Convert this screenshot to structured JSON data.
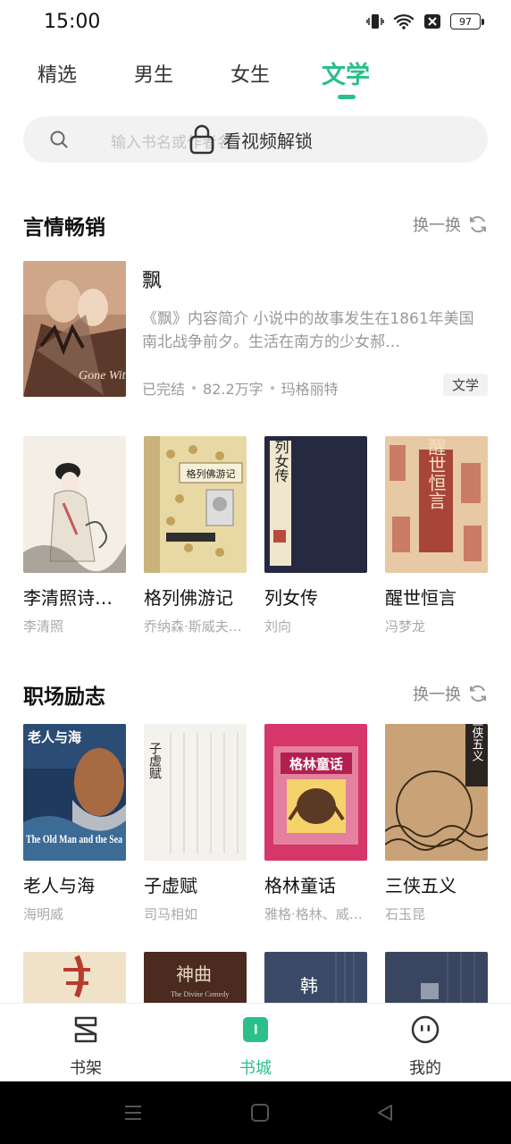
{
  "status": {
    "time": "15:00",
    "battery": "97"
  },
  "tabs": [
    {
      "label": "精选"
    },
    {
      "label": "男生"
    },
    {
      "label": "女生"
    },
    {
      "label": "文学",
      "active": true
    }
  ],
  "search": {
    "placeholder": "输入书名或作者名",
    "unlock_text": "看视频解锁"
  },
  "section1": {
    "title": "言情畅销",
    "refresh": "换一换"
  },
  "featured": {
    "title": "飘",
    "description": "《飘》内容简介 小说中的故事发生在1861年美国南北战争前夕。生活在南方的少女郝…",
    "status": "已完结",
    "word_count": "82.2万字",
    "author": "玛格丽特",
    "genre": "文学"
  },
  "row1": [
    {
      "title": "李清照诗…",
      "author": "李清照"
    },
    {
      "title": "格列佛游记",
      "author": "乔纳森·斯威夫…"
    },
    {
      "title": "列女传",
      "author": "刘向"
    },
    {
      "title": "醒世恒言",
      "author": "冯梦龙"
    }
  ],
  "section2": {
    "title": "职场励志",
    "refresh": "换一换"
  },
  "row2": [
    {
      "title": "老人与海",
      "author": "海明威"
    },
    {
      "title": "子虚赋",
      "author": "司马相如"
    },
    {
      "title": "格林童话",
      "author": "雅格·格林、威…"
    },
    {
      "title": "三侠五义",
      "author": "石玉昆"
    }
  ],
  "covers": {
    "gone_with_wind": "Gone With the Wind",
    "old_man_sea": "The Old Man and the Sea",
    "old_man_sea_cn": "老人与海",
    "lienv": "列女传",
    "xingshi": "醒世恒言",
    "grimm": "格林童话",
    "sanxia": "三侠五义",
    "gulliver": "格列佛游记",
    "zixu": "子虚赋",
    "shenqu": "神曲",
    "shenqu_en": "The Divine Comedy",
    "han": "韩"
  },
  "bottom_nav": [
    {
      "label": "书架"
    },
    {
      "label": "书城",
      "active": true
    },
    {
      "label": "我的"
    }
  ],
  "colors": {
    "accent": "#2bbf8a"
  }
}
